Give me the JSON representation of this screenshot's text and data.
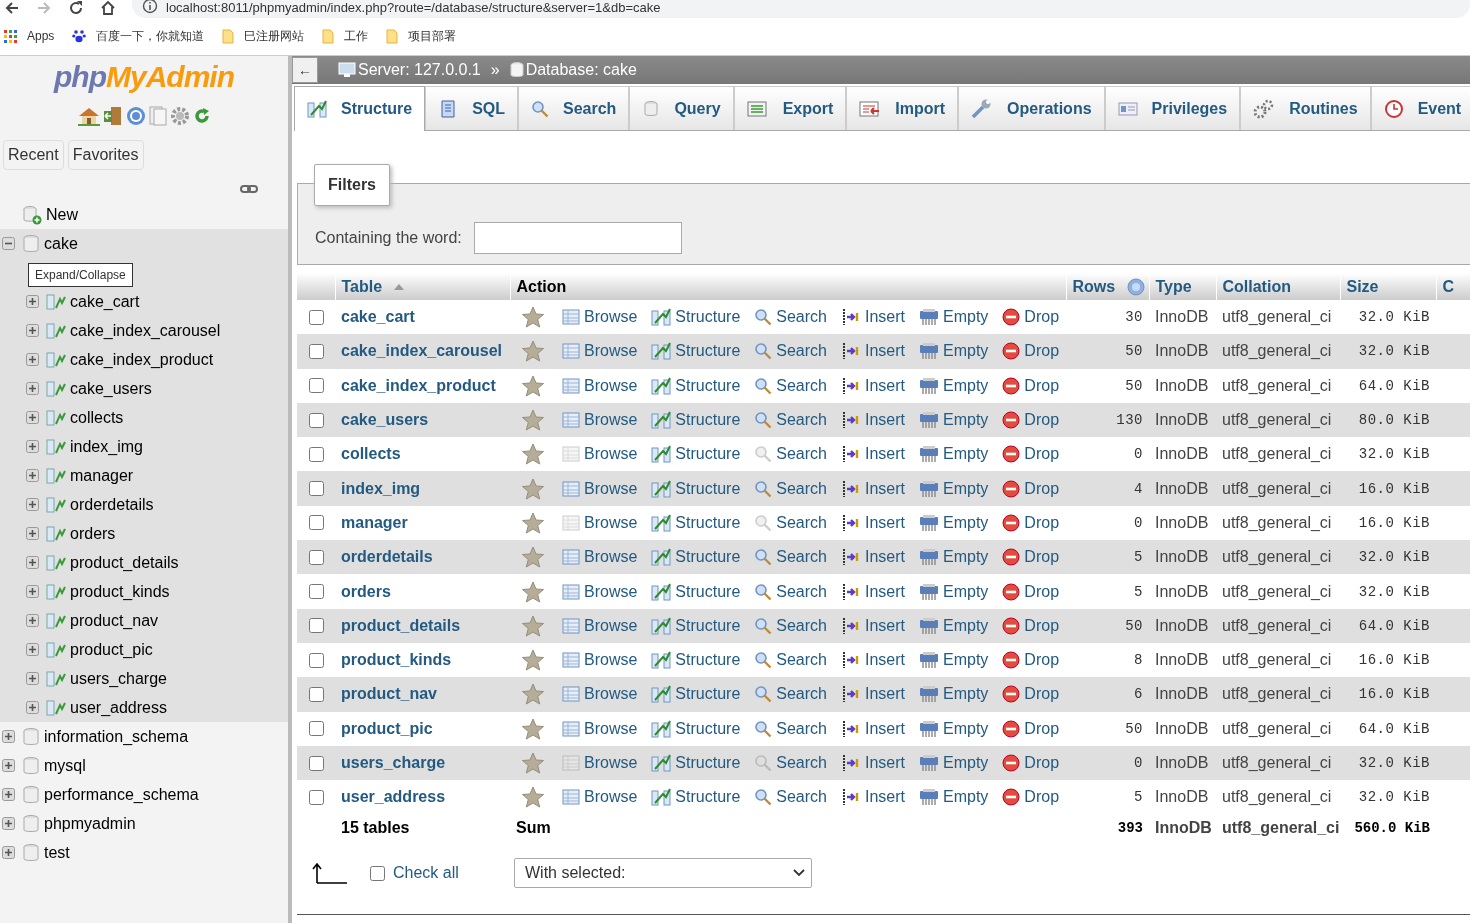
{
  "browser": {
    "url": "localhost:8011/phpmyadmin/index.php?route=/database/structure&server=1&db=cake",
    "bookmarks": [
      {
        "kind": "apps",
        "label": "Apps"
      },
      {
        "kind": "paw",
        "label": "百度一下，你就知道"
      },
      {
        "kind": "folder",
        "label": "巳注册网站"
      },
      {
        "kind": "folder",
        "label": "工作"
      },
      {
        "kind": "folder",
        "label": "项目部署"
      }
    ]
  },
  "sidebar": {
    "logo": [
      "php",
      "MyAdmin"
    ],
    "tabs": [
      "Recent",
      "Favorites"
    ],
    "tree": [
      {
        "kind": "new",
        "label": "New",
        "expanded": false
      },
      {
        "kind": "db",
        "label": "cake",
        "expanded": true,
        "children": [
          {
            "label": "cake_cart"
          },
          {
            "label": "cake_index_carousel"
          },
          {
            "label": "cake_index_product"
          },
          {
            "label": "cake_users"
          },
          {
            "label": "collects"
          },
          {
            "label": "index_img"
          },
          {
            "label": "manager"
          },
          {
            "label": "orderdetails"
          },
          {
            "label": "orders"
          },
          {
            "label": "product_details"
          },
          {
            "label": "product_kinds"
          },
          {
            "label": "product_nav"
          },
          {
            "label": "product_pic"
          },
          {
            "label": "users_charge"
          },
          {
            "label": "user_address"
          }
        ]
      },
      {
        "kind": "db",
        "label": "information_schema",
        "expanded": false
      },
      {
        "kind": "db",
        "label": "mysql",
        "expanded": false
      },
      {
        "kind": "db",
        "label": "performance_schema",
        "expanded": false
      },
      {
        "kind": "db",
        "label": "phpmyadmin",
        "expanded": false
      },
      {
        "kind": "db",
        "label": "test",
        "expanded": false
      }
    ],
    "tooltip": "Expand/Collapse"
  },
  "breadcrumb": {
    "back": "←",
    "server": "Server: 127.0.0.1",
    "separator": "»",
    "database": "Database: cake"
  },
  "tabs": [
    {
      "kind": "structure",
      "label": "Structure",
      "selected": true
    },
    {
      "kind": "sql",
      "label": "SQL",
      "selected": false
    },
    {
      "kind": "search",
      "label": "Search",
      "selected": false
    },
    {
      "kind": "query",
      "label": "Query",
      "selected": false
    },
    {
      "kind": "export",
      "label": "Export",
      "selected": false
    },
    {
      "kind": "import",
      "label": "Import",
      "selected": false
    },
    {
      "kind": "operations",
      "label": "Operations",
      "selected": false
    },
    {
      "kind": "privileges",
      "label": "Privileges",
      "selected": false
    },
    {
      "kind": "routines",
      "label": "Routines",
      "selected": false
    },
    {
      "kind": "events",
      "label": "Event",
      "selected": false
    }
  ],
  "filters": {
    "legend": "Filters",
    "label": "Containing the word:"
  },
  "table": {
    "columns": [
      "Table",
      "Action",
      "Rows",
      "Type",
      "Collation",
      "Size",
      "C"
    ],
    "rows": [
      {
        "checked": false,
        "name": "cake_cart",
        "empty": false,
        "actions": [
          "Browse",
          "Structure",
          "Search",
          "Insert",
          "Empty",
          "Drop"
        ],
        "rows": "30",
        "type": "InnoDB",
        "collation": "utf8_general_ci",
        "size": "32.0 KiB"
      },
      {
        "checked": false,
        "name": "cake_index_carousel",
        "empty": false,
        "actions": [
          "Browse",
          "Structure",
          "Search",
          "Insert",
          "Empty",
          "Drop"
        ],
        "rows": "50",
        "type": "InnoDB",
        "collation": "utf8_general_ci",
        "size": "32.0 KiB"
      },
      {
        "checked": false,
        "name": "cake_index_product",
        "empty": false,
        "actions": [
          "Browse",
          "Structure",
          "Search",
          "Insert",
          "Empty",
          "Drop"
        ],
        "rows": "50",
        "type": "InnoDB",
        "collation": "utf8_general_ci",
        "size": "64.0 KiB"
      },
      {
        "checked": false,
        "name": "cake_users",
        "empty": false,
        "actions": [
          "Browse",
          "Structure",
          "Search",
          "Insert",
          "Empty",
          "Drop"
        ],
        "rows": "130",
        "type": "InnoDB",
        "collation": "utf8_general_ci",
        "size": "80.0 KiB"
      },
      {
        "checked": false,
        "name": "collects",
        "empty": true,
        "actions": [
          "Browse",
          "Structure",
          "Search",
          "Insert",
          "Empty",
          "Drop"
        ],
        "rows": "0",
        "type": "InnoDB",
        "collation": "utf8_general_ci",
        "size": "32.0 KiB"
      },
      {
        "checked": false,
        "name": "index_img",
        "empty": false,
        "actions": [
          "Browse",
          "Structure",
          "Search",
          "Insert",
          "Empty",
          "Drop"
        ],
        "rows": "4",
        "type": "InnoDB",
        "collation": "utf8_general_ci",
        "size": "16.0 KiB"
      },
      {
        "checked": false,
        "name": "manager",
        "empty": true,
        "actions": [
          "Browse",
          "Structure",
          "Search",
          "Insert",
          "Empty",
          "Drop"
        ],
        "rows": "0",
        "type": "InnoDB",
        "collation": "utf8_general_ci",
        "size": "16.0 KiB"
      },
      {
        "checked": false,
        "name": "orderdetails",
        "empty": false,
        "actions": [
          "Browse",
          "Structure",
          "Search",
          "Insert",
          "Empty",
          "Drop"
        ],
        "rows": "5",
        "type": "InnoDB",
        "collation": "utf8_general_ci",
        "size": "32.0 KiB"
      },
      {
        "checked": false,
        "name": "orders",
        "empty": false,
        "actions": [
          "Browse",
          "Structure",
          "Search",
          "Insert",
          "Empty",
          "Drop"
        ],
        "rows": "5",
        "type": "InnoDB",
        "collation": "utf8_general_ci",
        "size": "32.0 KiB"
      },
      {
        "checked": false,
        "name": "product_details",
        "empty": false,
        "actions": [
          "Browse",
          "Structure",
          "Search",
          "Insert",
          "Empty",
          "Drop"
        ],
        "rows": "50",
        "type": "InnoDB",
        "collation": "utf8_general_ci",
        "size": "64.0 KiB"
      },
      {
        "checked": false,
        "name": "product_kinds",
        "empty": false,
        "actions": [
          "Browse",
          "Structure",
          "Search",
          "Insert",
          "Empty",
          "Drop"
        ],
        "rows": "8",
        "type": "InnoDB",
        "collation": "utf8_general_ci",
        "size": "16.0 KiB"
      },
      {
        "checked": false,
        "name": "product_nav",
        "empty": false,
        "actions": [
          "Browse",
          "Structure",
          "Search",
          "Insert",
          "Empty",
          "Drop"
        ],
        "rows": "6",
        "type": "InnoDB",
        "collation": "utf8_general_ci",
        "size": "16.0 KiB"
      },
      {
        "checked": false,
        "name": "product_pic",
        "empty": false,
        "actions": [
          "Browse",
          "Structure",
          "Search",
          "Insert",
          "Empty",
          "Drop"
        ],
        "rows": "50",
        "type": "InnoDB",
        "collation": "utf8_general_ci",
        "size": "64.0 KiB"
      },
      {
        "checked": false,
        "name": "users_charge",
        "empty": true,
        "actions": [
          "Browse",
          "Structure",
          "Search",
          "Insert",
          "Empty",
          "Drop"
        ],
        "rows": "0",
        "type": "InnoDB",
        "collation": "utf8_general_ci",
        "size": "32.0 KiB"
      },
      {
        "checked": false,
        "name": "user_address",
        "empty": false,
        "actions": [
          "Browse",
          "Structure",
          "Search",
          "Insert",
          "Empty",
          "Drop"
        ],
        "rows": "5",
        "type": "InnoDB",
        "collation": "utf8_general_ci",
        "size": "32.0 KiB"
      }
    ],
    "footer": {
      "count": "15 tables",
      "label": "Sum",
      "rows": "393",
      "type": "InnoDB",
      "collation": "utf8_general_ci",
      "size": "560.0 KiB"
    }
  },
  "bulk": {
    "check_all": {
      "label": "Check all",
      "checked": false
    },
    "select": "With selected:"
  }
}
